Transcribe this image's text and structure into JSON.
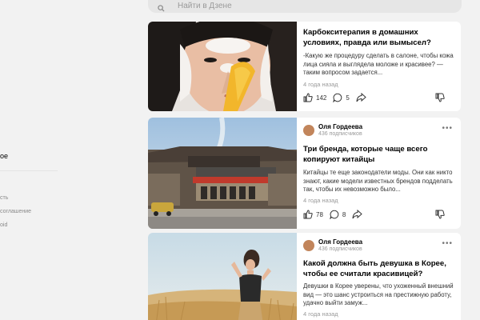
{
  "sidebar": {
    "active_item": "ое",
    "links": [
      "сть",
      "соглашение",
      "oid"
    ]
  },
  "search": {
    "placeholder": "Найти в Дзене"
  },
  "cards": [
    {
      "title": "Карбокситерапия в домашних условиях, правда или вымысел?",
      "snippet": "-Какую же процедуру сделать в салоне, чтобы кожа лица сияла и выглядела моложе и красивее? — таким вопросом задается...",
      "time": "4 года назад",
      "likes": "142",
      "comments": "5"
    },
    {
      "author": "Оля Гордеева",
      "subscribers": "436 подписчиков",
      "title": "Три бренда, которые чаще всего копируют китайцы",
      "snippet": "Китайцы те еще законодатели моды. Они как никто знают, какие модели известных брендов подделать так, чтобы их невозможно было...",
      "time": "4 года назад",
      "likes": "78",
      "comments": "8"
    },
    {
      "author": "Оля Гордеева",
      "subscribers": "436 подписчиков",
      "title": "Какой должна быть девушка в Корее, чтобы ее считали красивицей?",
      "snippet": "Девушки в Корее уверены, что ухоженный внешний вид — это шанс устроиться на престижную работу, удачно выйти замуж...",
      "time": "4 года назад"
    }
  ],
  "colors": {
    "background": "#f2f2f2",
    "card": "#ffffff",
    "muted": "#9a9a9a"
  },
  "icons": [
    "search-icon",
    "like-icon",
    "comment-icon",
    "share-icon",
    "dislike-icon",
    "more-icon"
  ]
}
